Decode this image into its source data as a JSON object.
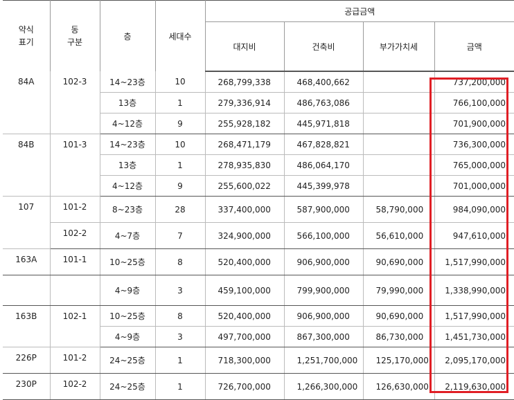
{
  "header": {
    "type": "약식\n표기",
    "dong": "동\n구분",
    "floor": "층",
    "households": "세대수",
    "supply_group": "공급금액",
    "land": "대지비",
    "building": "건축비",
    "vat": "부가가치세",
    "amount": "금액"
  },
  "rows": [
    {
      "type": "84A",
      "dong": "102-3",
      "floor": "14~23층",
      "count": "10",
      "land": "268,799,338",
      "building": "468,400,662",
      "vat": "",
      "amount": "737,200,000"
    },
    {
      "type": "",
      "dong": "",
      "floor": "13층",
      "count": "1",
      "land": "279,336,914",
      "building": "486,763,086",
      "vat": "",
      "amount": "766,100,000"
    },
    {
      "type": "",
      "dong": "",
      "floor": "4~12층",
      "count": "9",
      "land": "255,928,182",
      "building": "445,971,818",
      "vat": "",
      "amount": "701,900,000"
    },
    {
      "type": "84B",
      "dong": "101-3",
      "floor": "14~23층",
      "count": "10",
      "land": "268,471,179",
      "building": "467,828,821",
      "vat": "",
      "amount": "736,300,000"
    },
    {
      "type": "",
      "dong": "",
      "floor": "13층",
      "count": "1",
      "land": "278,935,830",
      "building": "486,064,170",
      "vat": "",
      "amount": "765,000,000"
    },
    {
      "type": "",
      "dong": "",
      "floor": "4~12층",
      "count": "9",
      "land": "255,600,022",
      "building": "445,399,978",
      "vat": "",
      "amount": "701,000,000"
    },
    {
      "type": "107",
      "dong": "101-2",
      "floor": "8~23층",
      "count": "28",
      "land": "337,400,000",
      "building": "587,900,000",
      "vat": "58,790,000",
      "amount": "984,090,000"
    },
    {
      "type": "",
      "dong": "102-2",
      "floor": "4~7층",
      "count": "7",
      "land": "324,900,000",
      "building": "566,100,000",
      "vat": "56,610,000",
      "amount": "947,610,000"
    },
    {
      "type": "163A",
      "dong": "101-1",
      "floor": "10~25층",
      "count": "8",
      "land": "520,400,000",
      "building": "906,900,000",
      "vat": "90,690,000",
      "amount": "1,517,990,000"
    },
    {
      "type": "",
      "dong": "",
      "floor": "4~9층",
      "count": "3",
      "land": "459,100,000",
      "building": "799,900,000",
      "vat": "79,990,000",
      "amount": "1,338,990,000"
    },
    {
      "type": "163B",
      "dong": "102-1",
      "floor": "10~25층",
      "count": "8",
      "land": "520,400,000",
      "building": "906,900,000",
      "vat": "90,690,000",
      "amount": "1,517,990,000"
    },
    {
      "type": "",
      "dong": "",
      "floor": "4~9층",
      "count": "3",
      "land": "497,700,000",
      "building": "867,300,000",
      "vat": "86,730,000",
      "amount": "1,451,730,000"
    },
    {
      "type": "226P",
      "dong": "101-2",
      "floor": "24~25층",
      "count": "1",
      "land": "718,300,000",
      "building": "1,251,700,000",
      "vat": "125,170,000",
      "amount": "2,095,170,000"
    },
    {
      "type": "230P",
      "dong": "102-2",
      "floor": "24~25층",
      "count": "1",
      "land": "726,700,000",
      "building": "1,266,300,000",
      "vat": "126,630,000",
      "amount": "2,119,630,000"
    }
  ],
  "highlight_color": "#e01e25"
}
